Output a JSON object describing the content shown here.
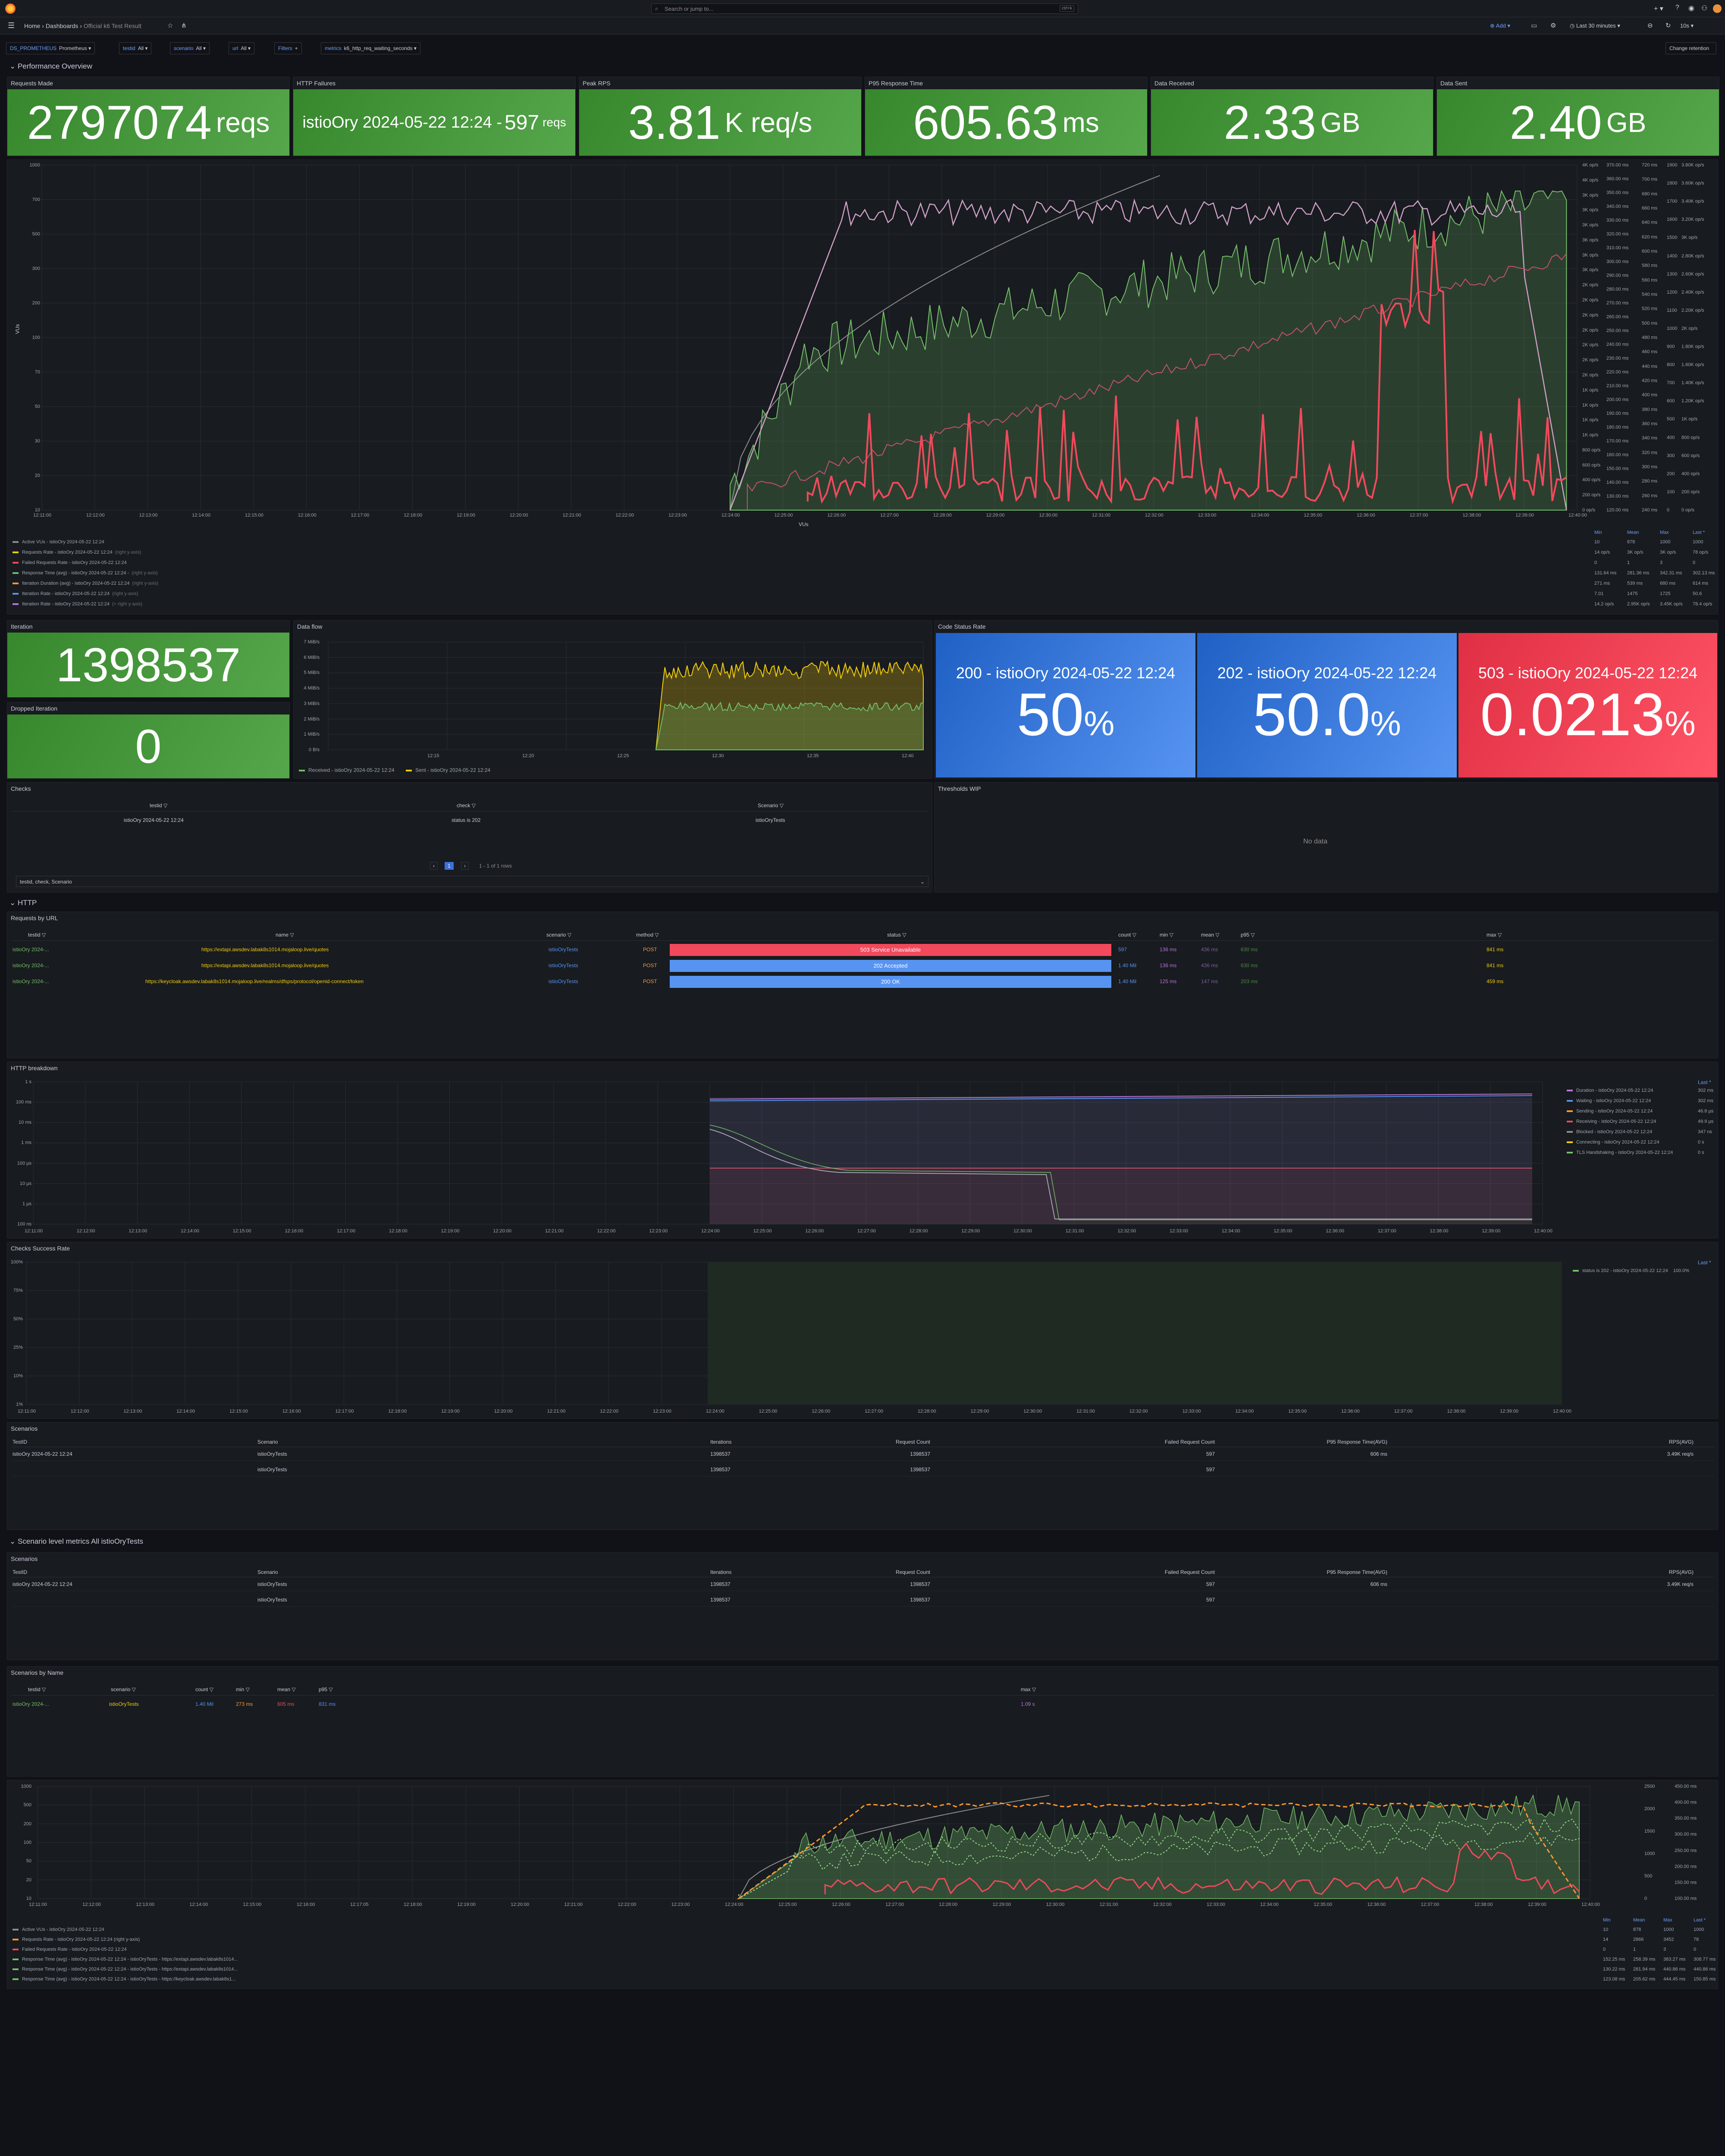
{
  "topbar": {
    "search_placeholder": "Search or jump to...",
    "search_shortcut": "ctrl+k"
  },
  "navbar": {
    "breadcrumb": [
      "Home",
      "Dashboards",
      "Official k6 Test Result"
    ],
    "add_label": "Add",
    "time_range": "Last 30 minutes",
    "refresh": "10s"
  },
  "variables": [
    {
      "label": "DS_PROMETHEUS",
      "value": "Prometheus"
    },
    {
      "label": "testid",
      "value": "All"
    },
    {
      "label": "scenario",
      "value": "All"
    },
    {
      "label": "url",
      "value": "All"
    },
    {
      "label": "Filters",
      "value": "+"
    },
    {
      "label": "metrics",
      "value": "k6_http_req_waiting_seconds"
    }
  ],
  "change_retention": "Change retention",
  "sections": {
    "perf": "Performance Overview",
    "http": "HTTP",
    "scenario_metrics": "Scenario level metrics All istioOryTests"
  },
  "stats": [
    {
      "title": "Requests Made",
      "value": "2797074",
      "unit": "reqs"
    },
    {
      "title": "HTTP Failures",
      "prefix": "istioOry 2024-05-22 12:24 - ",
      "value": "597",
      "unit": "reqs"
    },
    {
      "title": "Peak RPS",
      "value": "3.81",
      "unit": "K req/s"
    },
    {
      "title": "P95 Response Time",
      "value": "605.63",
      "unit": "ms"
    },
    {
      "title": "Data Received",
      "value": "2.33",
      "unit": "GB"
    },
    {
      "title": "Data Sent",
      "value": "2.40",
      "unit": "GB"
    }
  ],
  "main_chart": {
    "ylabel": "VUs",
    "xlabel": "VUs",
    "yticks": [
      "1000",
      "700",
      "500",
      "300",
      "200",
      "100",
      "70",
      "50",
      "30",
      "20",
      "10"
    ],
    "xticks": [
      "12:11:00",
      "12:12:00",
      "12:13:00",
      "12:14:00",
      "12:15:00",
      "12:16:00",
      "12:17:00",
      "12:18:00",
      "12:19:00",
      "12:20:00",
      "12:21:00",
      "12:22:00",
      "12:23:00",
      "12:24:00",
      "12:25:00",
      "12:26:00",
      "12:27:00",
      "12:28:00",
      "12:29:00",
      "12:30:00",
      "12:31:00",
      "12:32:00",
      "12:33:00",
      "12:34:00",
      "12:35:00",
      "12:36:00",
      "12:37:00",
      "12:38:00",
      "12:39:00",
      "12:40:00"
    ],
    "right_axis1": [
      "4K op/s",
      "4K op/s",
      "3K op/s",
      "3K op/s",
      "3K op/s",
      "3K op/s",
      "3K op/s",
      "3K op/s",
      "2K op/s",
      "2K op/s",
      "2K op/s",
      "2K op/s",
      "2K op/s",
      "2K op/s",
      "2K op/s",
      "1K op/s",
      "1K op/s",
      "1K op/s",
      "1K op/s",
      "800 op/s",
      "600 op/s",
      "400 op/s",
      "200 op/s",
      "0 op/s"
    ],
    "right_axis2": [
      "370.00 ms",
      "360.00 ms",
      "350.00 ms",
      "340.00 ms",
      "330.00 ms",
      "320.00 ms",
      "310.00 ms",
      "300.00 ms",
      "290.00 ms",
      "280.00 ms",
      "270.00 ms",
      "260.00 ms",
      "250.00 ms",
      "240.00 ms",
      "230.00 ms",
      "220.00 ms",
      "210.00 ms",
      "200.00 ms",
      "190.00 ms",
      "180.00 ms",
      "170.00 ms",
      "160.00 ms",
      "150.00 ms",
      "140.00 ms",
      "130.00 ms",
      "120.00 ms"
    ],
    "right_axis3": [
      "720 ms",
      "700 ms",
      "680 ms",
      "660 ms",
      "640 ms",
      "620 ms",
      "600 ms",
      "580 ms",
      "560 ms",
      "540 ms",
      "520 ms",
      "500 ms",
      "480 ms",
      "460 ms",
      "440 ms",
      "420 ms",
      "400 ms",
      "380 ms",
      "360 ms",
      "340 ms",
      "320 ms",
      "300 ms",
      "280 ms",
      "260 ms",
      "240 ms"
    ],
    "right_axis4": [
      "1900",
      "1800",
      "1700",
      "1600",
      "1500",
      "1400",
      "1300",
      "1200",
      "1100",
      "1000",
      "900",
      "800",
      "700",
      "600",
      "500",
      "400",
      "300",
      "200",
      "100",
      "0"
    ],
    "right_axis5": [
      "3.80K op/s",
      "3.60K op/s",
      "3.40K op/s",
      "3.20K op/s",
      "3K op/s",
      "2.80K op/s",
      "2.60K op/s",
      "2.40K op/s",
      "2.20K op/s",
      "2K op/s",
      "1.80K op/s",
      "1.60K op/s",
      "1.40K op/s",
      "1.20K op/s",
      "1K op/s",
      "800 op/s",
      "600 op/s",
      "400 op/s",
      "200 op/s",
      "0 op/s"
    ],
    "legend_headers": [
      "Min",
      "Mean",
      "Max",
      "Last *"
    ],
    "legend": [
      {
        "name": "Active VUs - istioOry 2024-05-22 12:24",
        "color": "#8e8e8e",
        "vals": [
          "10",
          "878",
          "1000",
          "1000"
        ]
      },
      {
        "name": "Requests Rate - istioOry 2024-05-22 12:24",
        "axis": "(right y-axis)",
        "color": "#f2cc0c",
        "vals": [
          "14 op/s",
          "3K op/s",
          "3K op/s",
          "78 op/s"
        ]
      },
      {
        "name": "Failed Requests Rate - istioOry 2024-05-22 12:24",
        "color": "#f2495c",
        "vals": [
          "0",
          "1",
          "3",
          "0"
        ]
      },
      {
        "name": "Response Time (avg) - istioOry 2024-05-22 12:24 -",
        "axis": "(right y-axis)",
        "color": "#73bf69",
        "vals": [
          "131.64 ms",
          "281.36 ms",
          "342.31 ms",
          "302.13 ms"
        ]
      },
      {
        "name": "Iteration Duration (avg) - istioOry 2024-05-22 12:24",
        "axis": "(right y-axis)",
        "color": "#ff9830",
        "vals": [
          "271 ms",
          "539 ms",
          "680 ms",
          "614 ms"
        ]
      },
      {
        "name": "Iteration Rate - istioOry 2024-05-22 12:24",
        "axis": "(right y-axis)",
        "color": "#5794f2",
        "vals": [
          "7.01",
          "1475",
          "1725",
          "50.6"
        ]
      },
      {
        "name": "Iteration Rate - istioOry 2024-05-22 12:24",
        "axis": "(+ right y-axis)",
        "color": "#b877d9",
        "vals": [
          "14.2 op/s",
          "2.95K op/s",
          "3.45K op/s",
          "78.4 op/s"
        ]
      }
    ]
  },
  "iteration": {
    "title": "Iteration",
    "value": "1398537"
  },
  "dropped": {
    "title": "Dropped Iteration",
    "value": "0"
  },
  "dataflow": {
    "title": "Data flow",
    "yticks": [
      "7 MiB/s",
      "6 MiB/s",
      "5 MiB/s",
      "4 MiB/s",
      "3 MiB/s",
      "2 MiB/s",
      "1 MiB/s",
      "0 B/s"
    ],
    "xticks": [
      "12:15",
      "12:20",
      "12:25",
      "12:30",
      "12:35",
      "12:40"
    ],
    "legend": [
      "Received - istioOry 2024-05-22 12:24",
      "Sent - istioOry 2024-05-22 12:24"
    ]
  },
  "code_status": {
    "title": "Code Status Rate",
    "items": [
      {
        "label": "200 - istioOry 2024-05-22 12:24",
        "value": "50",
        "unit": "%",
        "color": "#3274d9"
      },
      {
        "label": "202 - istioOry 2024-05-22 12:24",
        "value": "50.0",
        "unit": "%",
        "color": "#3274d9"
      },
      {
        "label": "503 - istioOry 2024-05-22 12:24",
        "value": "0.0213",
        "unit": "%",
        "color": "#f2495c"
      }
    ]
  },
  "checks": {
    "title": "Checks",
    "headers": [
      "testid",
      "check",
      "Scenario"
    ],
    "row": [
      "istioOry 2024-05-22 12:24",
      "status is 202",
      "istioOryTests"
    ],
    "pager": "1 - 1 of 1 rows",
    "page": "1",
    "footer": "testid, check, Scenario"
  },
  "thresholds": {
    "title": "Thresholds WIP",
    "empty": "No data"
  },
  "requests_by_url": {
    "title": "Requests by URL",
    "headers": [
      "testid",
      "name",
      "scenario",
      "method",
      "status",
      "count",
      "min",
      "mean",
      "p95",
      "max"
    ],
    "rows": [
      {
        "testid": "istioOry 2024-...",
        "name": "https://extapi.awsdev.labak8s1014.mojaloop.live/quotes",
        "scenario": "istioOryTests",
        "method": "POST",
        "status": "503 Service Unavailable",
        "status_color": "#f2495c",
        "count": "597",
        "min": "136 ms",
        "mean": "436 ms",
        "p95": "630 ms",
        "max": "841 ms"
      },
      {
        "testid": "istioOry 2024-...",
        "name": "https://extapi.awsdev.labak8s1014.mojaloop.live/quotes",
        "scenario": "istioOryTests",
        "method": "POST",
        "status": "202 Accepted",
        "status_color": "#5794f2",
        "count": "1.40 Mil",
        "min": "136 ms",
        "mean": "436 ms",
        "p95": "630 ms",
        "max": "841 ms"
      },
      {
        "testid": "istioOry 2024-...",
        "name": "https://keycloak.awsdev.labak8s1014.mojaloop.live/realms/dfsps/protocol/openid-connect/token",
        "scenario": "istioOryTests",
        "method": "POST",
        "status": "200 OK",
        "status_color": "#5794f2",
        "count": "1.40 Mil",
        "min": "125 ms",
        "mean": "147 ms",
        "p95": "203 ms",
        "max": "459 ms"
      }
    ]
  },
  "http_breakdown": {
    "title": "HTTP breakdown",
    "yticks": [
      "1 s",
      "100 ms",
      "10 ms",
      "1 ms",
      "100 µs",
      "10 µs",
      "1 µs",
      "100 ns"
    ],
    "xticks": [
      "12:11:00",
      "12:12:00",
      "12:13:00",
      "12:14:00",
      "12:15:00",
      "12:16:00",
      "12:17:00",
      "12:18:00",
      "12:19:00",
      "12:20:00",
      "12:21:00",
      "12:22:00",
      "12:23:00",
      "12:24:00",
      "12:25:00",
      "12:26:00",
      "12:27:00",
      "12:28:00",
      "12:29:00",
      "12:30:00",
      "12:31:00",
      "12:32:00",
      "12:33:00",
      "12:34:00",
      "12:35:00",
      "12:36:00",
      "12:37:00",
      "12:38:00",
      "12:39:00",
      "12:40:00"
    ],
    "legend_header": "Last *",
    "legend": [
      {
        "name": "Duration - istioOry 2024-05-22 12:24",
        "val": "302 ms",
        "color": "#b877d9"
      },
      {
        "name": "Waiting - istioOry 2024-05-22 12:24",
        "val": "302 ms",
        "color": "#5794f2"
      },
      {
        "name": "Sending - istioOry 2024-05-22 12:24",
        "val": "46.8 µs",
        "color": "#ff9830"
      },
      {
        "name": "Receiving - istioOry 2024-05-22 12:24",
        "val": "49.9 µs",
        "color": "#f2495c"
      },
      {
        "name": "Blocked - istioOry 2024-05-22 12:24",
        "val": "347 ns",
        "color": "#8e8e8e"
      },
      {
        "name": "Connecting - istioOry 2024-05-22 12:24",
        "val": "0 s",
        "color": "#f2cc0c"
      },
      {
        "name": "TLS Handshaking - istioOry 2024-05-22 12:24",
        "val": "0 s",
        "color": "#73bf69"
      }
    ]
  },
  "checks_success": {
    "title": "Checks Success Rate",
    "yticks": [
      "100%",
      "75%",
      "50%",
      "25%",
      "10%",
      "1%"
    ],
    "legend_header": "Last *",
    "legend": "status is 202 - istioOry 2024-05-22 12:24",
    "legend_val": "100.0%"
  },
  "scenarios1": {
    "title": "Scenarios",
    "headers": [
      "TestID",
      "Scenario",
      "Iterations",
      "Request Count",
      "Failed Request Count",
      "P95 Response Time(AVG)",
      "RPS(AVG)"
    ],
    "rows": [
      [
        "istioOry 2024-05-22 12:24",
        "istioOryTests",
        "1398537",
        "1398537",
        "597",
        "606 ms",
        "3.49K req/s"
      ],
      [
        "",
        "istioOryTests",
        "1398537",
        "1398537",
        "597",
        "",
        ""
      ]
    ]
  },
  "scenarios2": {
    "title": "Scenarios",
    "headers": [
      "TestID",
      "Scenario",
      "Iterations",
      "Request Count",
      "Failed Request Count",
      "P95 Response Time(AVG)",
      "RPS(AVG)"
    ],
    "rows": [
      [
        "istioOry 2024-05-22 12:24",
        "istioOryTests",
        "1398537",
        "1398537",
        "597",
        "606 ms",
        "3.49K req/s"
      ],
      [
        "",
        "istioOryTests",
        "1398537",
        "1398537",
        "597",
        "",
        ""
      ]
    ]
  },
  "scen_by_name": {
    "title": "Scenarios by Name",
    "headers": [
      "testid",
      "scenario",
      "count",
      "min",
      "mean",
      "p95",
      "max"
    ],
    "row": [
      "istioOry 2024-...",
      "istioOryTests",
      "1.40 Mil",
      "273 ms",
      "605 ms",
      "831 ms",
      "1.09 s"
    ]
  },
  "bottom_chart": {
    "yticks": [
      "1000",
      "500",
      "200",
      "100",
      "50",
      "20",
      "10"
    ],
    "xticks": [
      "12:11:00",
      "12:12:00",
      "12:13:00",
      "12:14:00",
      "12:15:00",
      "12:16:00",
      "12:17:05",
      "12:18:00",
      "12:19:00",
      "12:20:00",
      "12:21:00",
      "12:22:00",
      "12:23:00",
      "12:24:00",
      "12:25:00",
      "12:26:00",
      "12:27:00",
      "12:28:00",
      "12:29:00",
      "12:30:00",
      "12:31:00",
      "12:32:00",
      "12:33:00",
      "12:34:00",
      "12:35:00",
      "12:36:00",
      "12:37:00",
      "12:38:00",
      "12:39:00",
      "12:40:00"
    ],
    "right_a": [
      "2500",
      "2000",
      "1500",
      "1000",
      "500",
      "0"
    ],
    "right_b": [
      "450.00 ms",
      "400.00 ms",
      "350.00 ms",
      "300.00 ms",
      "250.00 ms",
      "200.00 ms",
      "150.00 ms",
      "100.00 ms"
    ],
    "legend_headers": [
      "Min",
      "Mean",
      "Max",
      "Last *"
    ],
    "legend": [
      {
        "name": "Active VUs - istioOry 2024-05-22 12:24",
        "color": "#8e8e8e",
        "vals": [
          "10",
          "878",
          "1000",
          "1000"
        ]
      },
      {
        "name": "Requests Rate - istioOry 2024-05-22 12:24 (right y-axis)",
        "color": "#ff9830",
        "vals": [
          "14",
          "2866",
          "3452",
          "78"
        ]
      },
      {
        "name": "Failed Requests Rate - istioOry 2024-05-22 12:24",
        "color": "#f2495c",
        "vals": [
          "0",
          "1",
          "3",
          "0"
        ]
      },
      {
        "name": "Response Time (avg) - istioOry 2024-05-22 12:24 - istioOryTests - https://extapi.awsdev.labak8s1014...",
        "color": "#73bf69",
        "vals": [
          "152.25 ms",
          "258.39 ms",
          "383.27 ms",
          "308.77 ms"
        ]
      },
      {
        "name": "Response Time (avg) - istioOry 2024-05-22 12:24 - istioOryTests - https://extapi.awsdev.labak8s1014...",
        "color": "#73bf69",
        "vals": [
          "130.22 ms",
          "281.94 ms",
          "440.86 ms",
          "440.86 ms"
        ]
      },
      {
        "name": "Response Time (avg) - istioOry 2024-05-22 12:24 - istioOryTests - https://keycloak.awsdev.labak8s1...",
        "color": "#73bf69",
        "vals": [
          "123.08 ms",
          "205.62 ms",
          "444.45 ms",
          "150.85 ms"
        ]
      }
    ]
  }
}
